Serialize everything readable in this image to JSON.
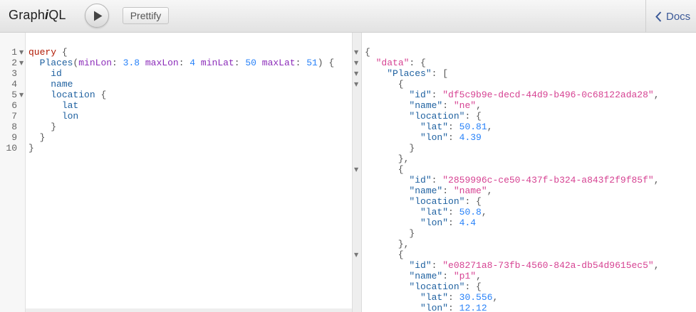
{
  "header": {
    "title_prefix": "Graph",
    "title_i": "i",
    "title_suffix": "QL",
    "prettify_label": "Prettify",
    "docs_label": "Docs"
  },
  "query_editor": {
    "lines": [
      {
        "num": "1",
        "fold": true
      },
      {
        "num": "2",
        "fold": true
      },
      {
        "num": "3",
        "fold": false
      },
      {
        "num": "4",
        "fold": false
      },
      {
        "num": "5",
        "fold": true
      },
      {
        "num": "6",
        "fold": false
      },
      {
        "num": "7",
        "fold": false
      },
      {
        "num": "8",
        "fold": false
      },
      {
        "num": "9",
        "fold": false
      },
      {
        "num": "10",
        "fold": false
      }
    ],
    "tokens": {
      "query_kw": "query",
      "brace_open": " {",
      "places_field": "Places",
      "min_lon_arg": "minLon",
      "min_lon_val": "3.8",
      "max_lon_arg": "maxLon",
      "max_lon_val": "4",
      "min_lat_arg": "minLat",
      "min_lat_val": "50",
      "max_lat_arg": "maxLat",
      "max_lat_val": "51",
      "id_field": "id",
      "name_field": "name",
      "location_field": "location",
      "lat_field": "lat",
      "lon_field": "lon"
    }
  },
  "result": {
    "data_key": "\"data\"",
    "places_key": "\"Places\"",
    "id_key": "\"id\"",
    "name_key": "\"name\"",
    "location_key": "\"location\"",
    "lat_key": "\"lat\"",
    "lon_key": "\"lon\"",
    "places": [
      {
        "id": "\"df5c9b9e-decd-44d9-b496-0c68122ada28\"",
        "name": "\"ne\"",
        "lat": "50.81",
        "lon": "4.39"
      },
      {
        "id": "\"2859996c-ce50-437f-b324-a843f2f9f85f\"",
        "name": "\"name\"",
        "lat": "50.8",
        "lon": "4.4"
      },
      {
        "id": "\"e08271a8-73fb-4560-842a-db54d9615ec5\"",
        "name": "\"p1\"",
        "lat": "30.556",
        "lon": "12.12"
      }
    ]
  },
  "colors": {
    "keyword": "#b11a04",
    "field": "#1f61a0",
    "argument": "#8b2bb9",
    "number": "#2882f9",
    "string": "#d64292",
    "docs_link": "#3b5998"
  }
}
